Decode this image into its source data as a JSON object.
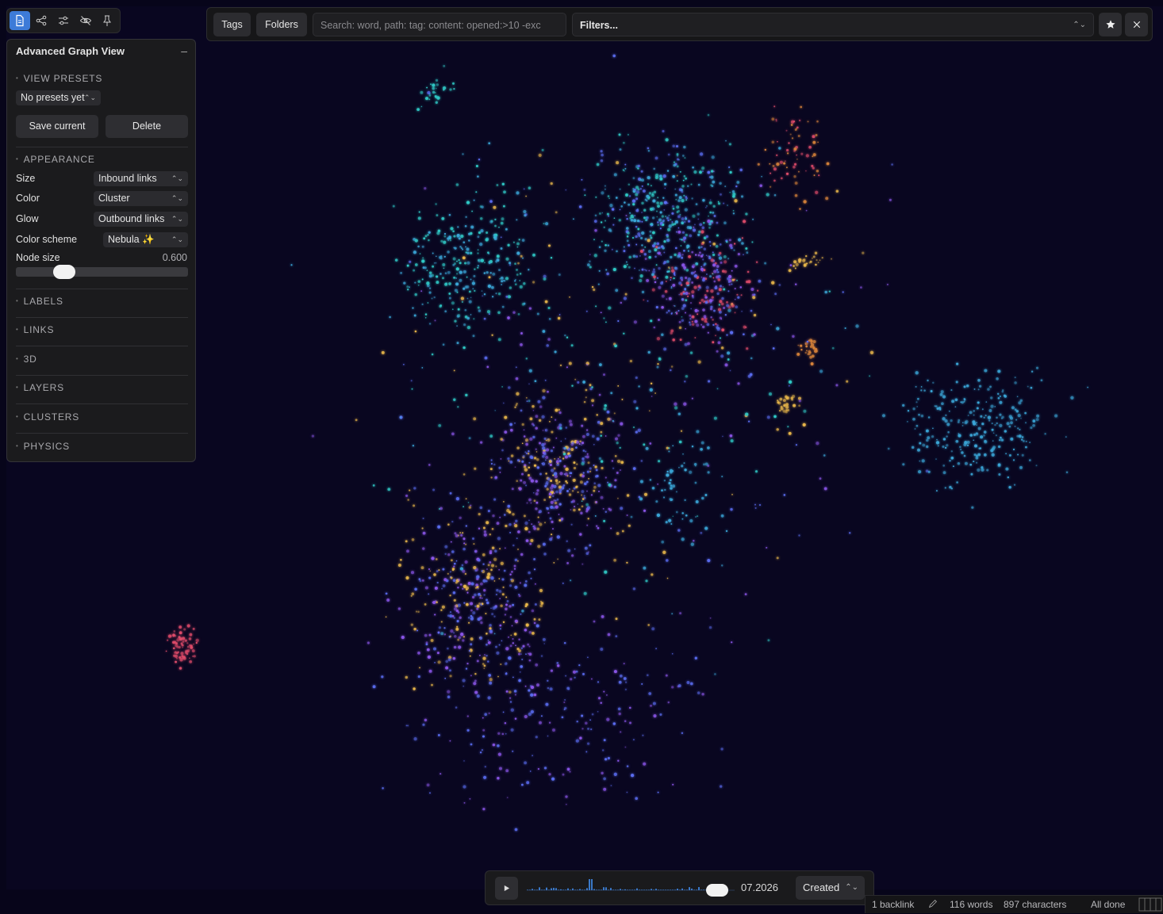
{
  "toolbar": {
    "icons": [
      "file-icon",
      "graph-nodes-icon",
      "sliders-icon",
      "eye-off-icon",
      "pin-icon"
    ],
    "active_index": 0
  },
  "panel": {
    "title": "Advanced Graph View",
    "collapse": "–",
    "view_presets": {
      "heading": "VIEW PRESETS",
      "selected": "No presets yet",
      "save_label": "Save current",
      "delete_label": "Delete"
    },
    "appearance": {
      "heading": "APPEARANCE",
      "size_label": "Size",
      "size_value": "Inbound links",
      "color_label": "Color",
      "color_value": "Cluster",
      "glow_label": "Glow",
      "glow_value": "Outbound links",
      "scheme_label": "Color scheme",
      "scheme_value": "Nebula ✨",
      "node_size_label": "Node size",
      "node_size_value": "0.600",
      "node_size_fraction": 0.25
    },
    "sections": [
      "LABELS",
      "LINKS",
      "3D",
      "LAYERS",
      "CLUSTERS",
      "PHYSICS"
    ]
  },
  "topbar": {
    "tags_label": "Tags",
    "folders_label": "Folders",
    "search_placeholder": "Search: word, path: tag: content: opened:>10 -exc",
    "filters_label": "Filters...",
    "star_icon": "star-icon",
    "close_icon": "close-icon"
  },
  "timeline": {
    "date": "07.2026",
    "mode": "Created",
    "position_fraction": 0.96
  },
  "status": {
    "backlinks": "1 backlink",
    "words": "116 words",
    "characters": "897 characters",
    "sync": "All done"
  },
  "colors": {
    "background": "#090620",
    "accent": "#3d7bd8",
    "nebula": [
      "#3aa6d8",
      "#2fc9c6",
      "#5a6cf0",
      "#8a55e8",
      "#e8b64a",
      "#e04b6a",
      "#d8833a"
    ]
  }
}
